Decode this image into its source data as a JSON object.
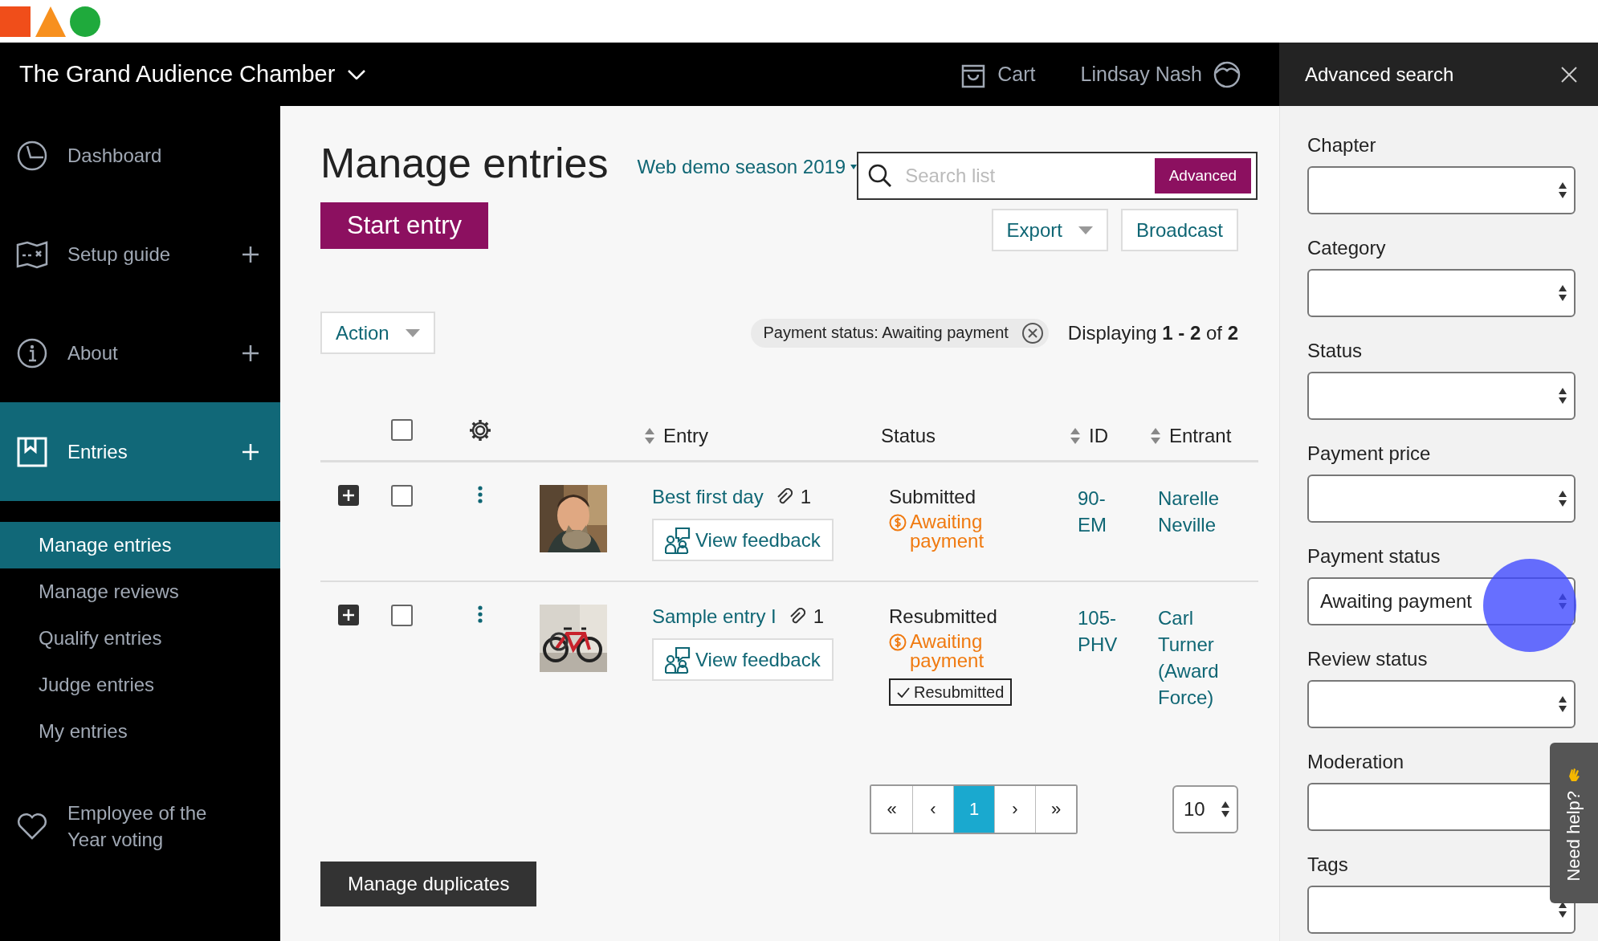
{
  "header": {
    "org": "The Grand Audience Chamber",
    "cart": "Cart",
    "user": "Lindsay Nash"
  },
  "sidebar": {
    "items": [
      {
        "label": "Dashboard",
        "expandable": false,
        "selected": false
      },
      {
        "label": "Setup guide",
        "expandable": true,
        "selected": false
      },
      {
        "label": "About",
        "expandable": true,
        "selected": false
      },
      {
        "label": "Entries",
        "expandable": true,
        "selected": true,
        "children": [
          {
            "label": "Manage entries",
            "selected": true
          },
          {
            "label": "Manage reviews",
            "selected": false
          },
          {
            "label": "Qualify entries",
            "selected": false
          },
          {
            "label": "Judge entries",
            "selected": false
          },
          {
            "label": "My entries",
            "selected": false
          }
        ]
      },
      {
        "label": "Employee of the Year voting",
        "expandable": false,
        "selected": false
      }
    ]
  },
  "main": {
    "title": "Manage entries",
    "season": "Web demo season 2019",
    "search": {
      "placeholder": "Search list",
      "button": "Advanced"
    },
    "start_button": "Start entry",
    "export_button": "Export",
    "broadcast_button": "Broadcast",
    "action_button": "Action",
    "filter_chip": "Payment status: Awaiting payment",
    "displaying": "Displaying **1 - 2** of **2**",
    "table": {
      "select_all_checked": false,
      "columns": [
        {
          "label": "Entry",
          "sortable": true
        },
        {
          "label": "Status",
          "sortable": false
        },
        {
          "label": "ID",
          "sortable": true
        },
        {
          "label": "Entrant",
          "sortable": true
        }
      ],
      "rows": [
        {
          "checked": false,
          "title": "Best first day",
          "attachments": "1",
          "feedback": "View feedback",
          "status": "Submitted",
          "payment": "Awaiting payment",
          "id": "90-EM",
          "entrant": "Narelle Neville"
        },
        {
          "checked": false,
          "title": "Sample entry I",
          "attachments": "1",
          "feedback": "View feedback",
          "status": "Resubmitted",
          "payment": "Awaiting payment",
          "badge": "Resubmitted",
          "id": "105-PHV",
          "entrant": "Carl Turner (Award Force)"
        }
      ]
    },
    "pagination": {
      "pages": [
        {
          "label": "«",
          "selected": false
        },
        {
          "label": "‹",
          "selected": false
        },
        {
          "label": "1",
          "selected": true
        },
        {
          "label": "›",
          "selected": false
        },
        {
          "label": "»",
          "selected": false
        }
      ],
      "per_page": "10"
    },
    "manage_duplicates": "Manage duplicates"
  },
  "advanced_search": {
    "title": "Advanced search",
    "fields": [
      {
        "label": "Chapter",
        "kind": "select"
      },
      {
        "label": "Category",
        "kind": "select"
      },
      {
        "label": "Status",
        "kind": "select"
      },
      {
        "label": "Payment price",
        "kind": "select"
      },
      {
        "label": "Payment status",
        "kind": "select",
        "value": "Awaiting payment"
      },
      {
        "label": "Review status",
        "kind": "select"
      },
      {
        "label": "Moderation",
        "kind": "text"
      },
      {
        "label": "Tags",
        "kind": "select"
      }
    ],
    "help_tab": "Need help?"
  }
}
